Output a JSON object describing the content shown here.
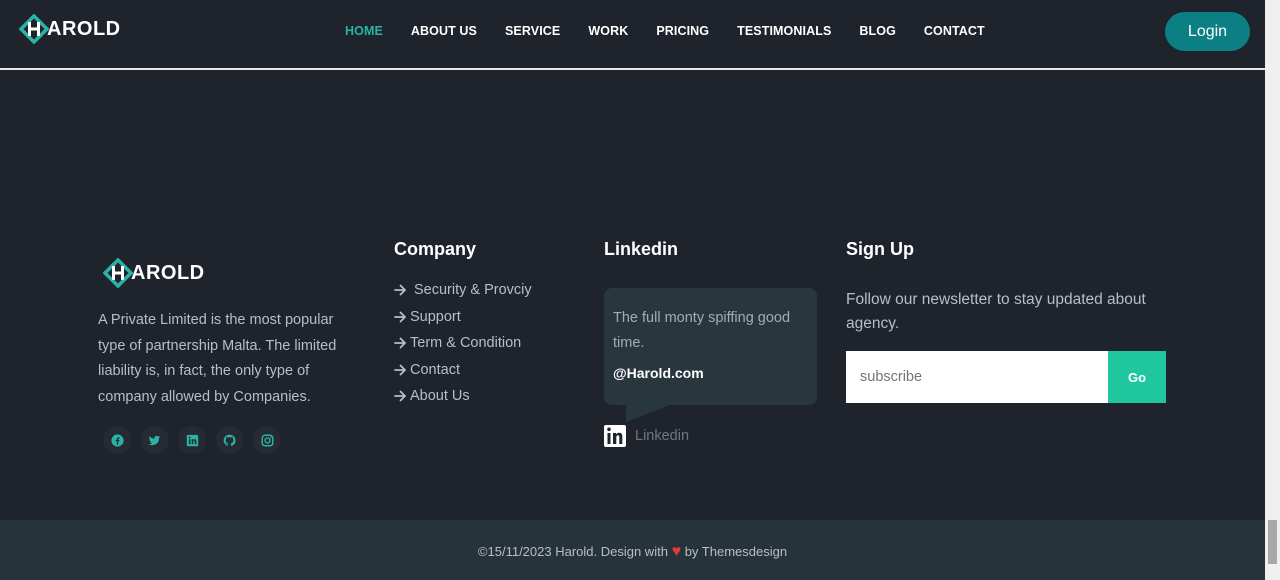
{
  "header": {
    "brand": "AROLD",
    "nav": [
      {
        "label": "HOME",
        "active": true
      },
      {
        "label": "ABOUT US"
      },
      {
        "label": "SERVICE"
      },
      {
        "label": "WORK"
      },
      {
        "label": "PRICING"
      },
      {
        "label": "TESTIMONIALS"
      },
      {
        "label": "BLOG"
      },
      {
        "label": "CONTACT"
      }
    ],
    "login_label": "Login"
  },
  "footer": {
    "brand": "AROLD",
    "about": "A Private Limited is the most popular type of partnership Malta. The limited liability is, in fact, the only type of company allowed by Companies.",
    "socials": [
      "facebook-icon",
      "twitter-icon",
      "linkedin-icon",
      "github-icon",
      "instagram-icon"
    ],
    "company": {
      "title": "Company",
      "links": [
        "Security & Provciy",
        "Support",
        "Term & Condition",
        "Contact",
        "About Us"
      ]
    },
    "linkedin": {
      "title": "Linkedin",
      "quote": "The full monty spiffing good time.",
      "handle": "@Harold.com",
      "label": "Linkedin"
    },
    "signup": {
      "title": "Sign Up",
      "text": "Follow our newsletter to stay updated about agency.",
      "placeholder": "subscribe",
      "button": "Go"
    },
    "copyright_before": "©15/11/2023 Harold. Design with",
    "copyright_after": "by Themesdesign"
  },
  "colors": {
    "background": "#1f232c",
    "accent": "#2ab3a6",
    "login_bg": "#0c7f84",
    "go_bg": "#20c69e",
    "bottom_bar": "#26343a",
    "heart": "#e23b3b"
  }
}
